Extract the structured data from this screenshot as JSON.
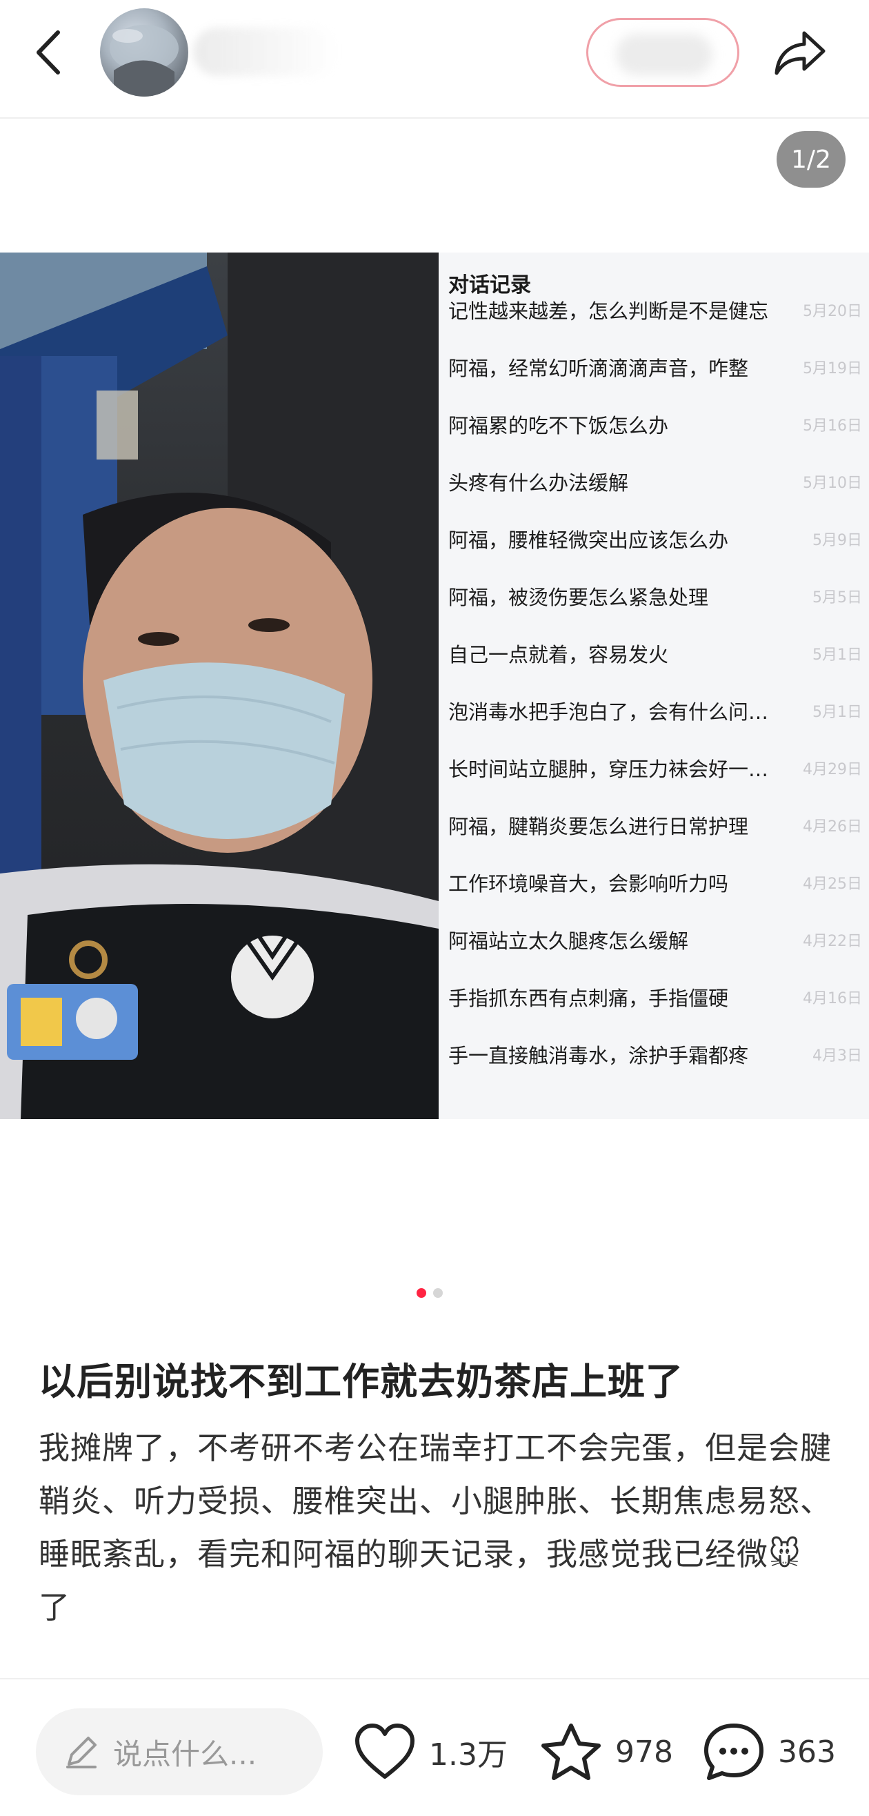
{
  "header": {
    "back_icon": "chevron-left-icon",
    "share_icon": "share-arrow-icon"
  },
  "carousel": {
    "page_indicator": "1/2",
    "current_index": 1,
    "total": 2,
    "active_color": "#ff2442"
  },
  "chat_panel": {
    "title": "对话记录",
    "rows": [
      {
        "q": "记性越来越差，怎么判断是不是健忘",
        "date": "5月20日"
      },
      {
        "q": "阿福，经常幻听滴滴滴声音，咋整",
        "date": "5月19日"
      },
      {
        "q": "阿福累的吃不下饭怎么办",
        "date": "5月16日"
      },
      {
        "q": "头疼有什么办法缓解",
        "date": "5月10日"
      },
      {
        "q": "阿福，腰椎轻微突出应该怎么办",
        "date": "5月9日"
      },
      {
        "q": "阿福，被烫伤要怎么紧急处理",
        "date": "5月5日"
      },
      {
        "q": "自己一点就着，容易发火",
        "date": "5月1日"
      },
      {
        "q": "泡消毒水把手泡白了，会有什么问…",
        "date": "5月1日"
      },
      {
        "q": "长时间站立腿肿，穿压力袜会好一…",
        "date": "4月29日"
      },
      {
        "q": "阿福，腱鞘炎要怎么进行日常护理",
        "date": "4月26日"
      },
      {
        "q": "工作环境噪音大，会影响听力吗",
        "date": "4月25日"
      },
      {
        "q": "阿福站立太久腿疼怎么缓解",
        "date": "4月22日"
      },
      {
        "q": "手指抓东西有点刺痛，手指僵硬",
        "date": "4月16日"
      },
      {
        "q": "手一直接触消毒水，涂护手霜都疼",
        "date": "4月3日"
      }
    ]
  },
  "post": {
    "title": "以后别说找不到工作就去奶茶店上班了",
    "body": "我摊牌了，不考研不考公在瑞幸打工不会完蛋，但是会腱鞘炎、听力受损、腰椎突出、小腿肿胀、长期焦虑易怒、睡眠紊乱，看完和阿福的聊天记录，我感觉我已经微🐭了"
  },
  "bottom_bar": {
    "comment_placeholder": "说点什么...",
    "likes": "1.3万",
    "favorites": "978",
    "comments": "363",
    "icons": [
      "pencil-icon",
      "heart-icon",
      "star-icon",
      "comment-bubble-icon"
    ]
  }
}
